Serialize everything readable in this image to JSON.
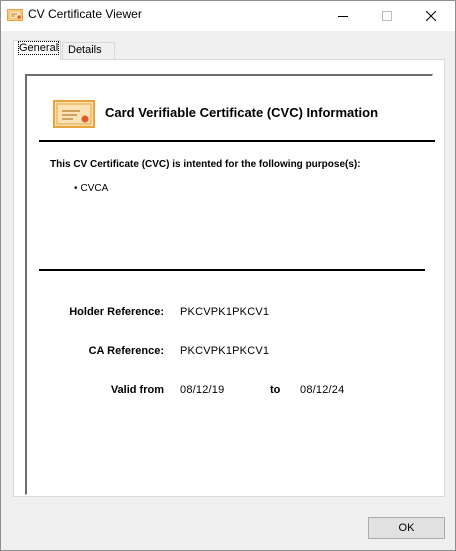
{
  "window": {
    "title": "CV Certificate Viewer",
    "icons": {
      "app": "certificate-icon",
      "minimize": "minimize-icon",
      "maximize": "maximize-icon",
      "close": "close-icon"
    }
  },
  "tabs": [
    {
      "label": "General",
      "active": true
    },
    {
      "label": "Details",
      "active": false
    }
  ],
  "general": {
    "heading_icon": "certificate-icon",
    "heading": "Card Verifiable Certificate (CVC) Information",
    "purpose_intro": "This CV Certificate (CVC) is intented for the following purpose(s):",
    "purposes": [
      "CVCA"
    ],
    "fields": {
      "holder_reference_label": "Holder Reference:",
      "holder_reference_value": "PKCVPK1PKCV1",
      "ca_reference_label": "CA Reference:",
      "ca_reference_value": "PKCVPK1PKCV1",
      "valid_from_label": "Valid from",
      "valid_from_value": "08/12/19",
      "valid_to_label": "to",
      "valid_to_value": "08/12/24"
    }
  },
  "buttons": {
    "ok": "OK"
  },
  "colors": {
    "certificate_orange": "#e8a33c",
    "certificate_fill": "#fbe2b4",
    "seal_red": "#e05a2b"
  }
}
